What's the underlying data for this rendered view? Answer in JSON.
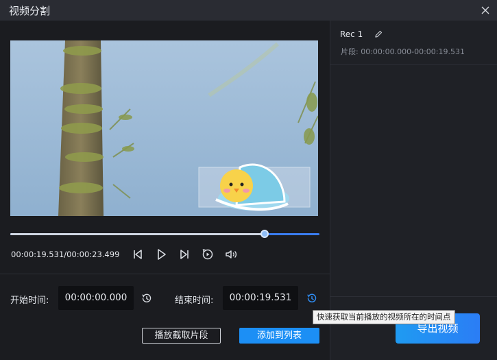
{
  "window": {
    "title": "视频分割",
    "close_icon": "close-icon"
  },
  "player": {
    "progress": 0.822,
    "timecode": "00:00:19.531/00:00:23.499",
    "controls": [
      "previous-icon",
      "play-icon",
      "next-icon",
      "loop-icon",
      "volume-icon"
    ]
  },
  "cut": {
    "start_label": "开始时间:",
    "start_value": "00:00:00.000",
    "end_label": "结束时间:",
    "end_value": "00:00:19.531",
    "play_segment_label": "播放截取片段",
    "add_to_list_label": "添加到列表"
  },
  "list": {
    "items": [
      {
        "name": "Rec 1",
        "segment": "片段: 00:00:00.000-00:00:19.531"
      }
    ]
  },
  "export_label": "导出视频",
  "tooltip": "快速获取当前播放的视频所在的时间点",
  "colors": {
    "accent": "#1c8ff5",
    "background": "#1b1c20",
    "titlebar": "#2a2c33"
  }
}
